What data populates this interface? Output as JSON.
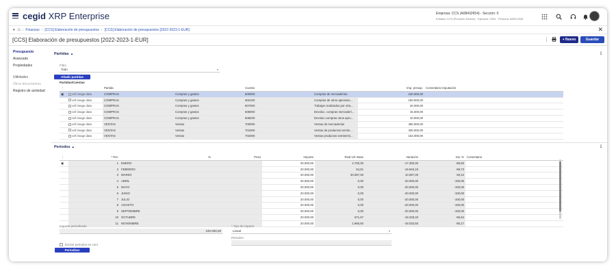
{
  "brand": {
    "bold": "cegid",
    "rest": " XRP Enterprise"
  },
  "empresa": {
    "line1": "Empresa: CCS (A08432654) - Sección: 0",
    "line2": "Entidad: CCS (Provecto Demos) · Ejercicio: 2024 · Persona: ADR12345"
  },
  "breadcrumb": [
    "Finanzas",
    "[CCS] Elaboración de presupuestos",
    "[CCS] Elaboración de presupuestos [2022-2023-1-EUR]"
  ],
  "page_title": "[CCS] Elaboración de presupuestos [2022-2023-1-EUR]",
  "buttons": {
    "nuevo": "+ Nuevo",
    "guardar": "Guardar"
  },
  "sidebar": {
    "items": [
      "Presupuesto",
      "Avanzado",
      "Propiedades"
    ],
    "group": "Utilidades",
    "util_items": [
      "Otros documentos",
      "Registro de actividad"
    ]
  },
  "partidas": {
    "title": "Partidas",
    "filter_label": "Filtro",
    "filter_value": "Todo",
    "add_button": "Añadir partidas",
    "grid_title": "Partidas/Cuentas",
    "columns": [
      "",
      "",
      "Partida",
      "",
      "Cuenta",
      "",
      "Imp. presup.",
      "Comentario imputación"
    ],
    "rows": [
      {
        "img": "cell image data",
        "partida": "COMPRAS",
        "tipo": "Compras y gastos",
        "cuenta": "600000",
        "desc": "Compras de mercaderías",
        "imp": "240.000,00"
      },
      {
        "img": "cell image data",
        "partida": "COMPRAS",
        "tipo": "Compras y gastos",
        "cuenta": "602100",
        "desc": "Compras de otros aprovisio...",
        "imp": "160.000,00"
      },
      {
        "img": "cell image data",
        "partida": "COMPRAS",
        "tipo": "Compras y gastos",
        "cuenta": "607000",
        "desc": "Trabajos realizados por otra...",
        "imp": "20.000,00"
      },
      {
        "img": "cell image data",
        "partida": "COMPRAS",
        "tipo": "Compras y gastos",
        "cuenta": "608000",
        "desc": "Devoluc. compras mercaderí...",
        "imp": "15.000,00"
      },
      {
        "img": "cell image data",
        "partida": "COMPRAS",
        "tipo": "Compras y gastos",
        "cuenta": "608200",
        "desc": "Devoluc.compras otros apro...",
        "imp": "10.000,00"
      },
      {
        "img": "cell image data",
        "partida": "VENTAS",
        "tipo": "Ventas",
        "cuenta": "700000",
        "desc": "Ventas de mercaderías",
        "imp": "480.000,00"
      },
      {
        "img": "cell image data",
        "partida": "VENTAS",
        "tipo": "Ventas",
        "cuenta": "701000",
        "desc": "Ventas de productos termin...",
        "imp": "330.000,00"
      },
      {
        "img": "cell image data",
        "partida": "VENTAS",
        "tipo": "Ventas",
        "cuenta": "702000",
        "desc": "Ventas productos semitermi...",
        "imp": "152.000,00"
      }
    ]
  },
  "periodos": {
    "title": "Periodos",
    "columns": [
      "* Per.",
      "",
      "%",
      "Peso",
      "Importe",
      "Real Ult. Base",
      "Variación",
      "Var. %",
      "Comentario"
    ],
    "rows": [
      {
        "n": "1",
        "mes": "ENERO",
        "imp": "20.000,00",
        "real": "2.700,00",
        "var": "-17.300,00",
        "varp": "-86,50"
      },
      {
        "n": "2",
        "mes": "FEBRERO",
        "imp": "20.000,00",
        "real": "54,81",
        "var": "-19.945,19",
        "varp": "-99,73"
      },
      {
        "n": "3",
        "mes": "MARZO",
        "imp": "20.000,00",
        "real": "30.087,00",
        "var": "10.087,00",
        "varp": "50,44"
      },
      {
        "n": "4",
        "mes": "ABRIL",
        "imp": "20.000,00",
        "real": "0,00",
        "var": "-20.000,00",
        "varp": "-100,00"
      },
      {
        "n": "5",
        "mes": "MAYO",
        "imp": "20.000,00",
        "real": "0,00",
        "var": "-20.000,00",
        "varp": "-100,00"
      },
      {
        "n": "6",
        "mes": "JUNIO",
        "imp": "20.000,00",
        "real": "0,00",
        "var": "-20.000,00",
        "varp": "-100,00"
      },
      {
        "n": "7",
        "mes": "JULIO",
        "imp": "20.000,00",
        "real": "0,00",
        "var": "-20.000,00",
        "varp": "-100,00"
      },
      {
        "n": "8",
        "mes": "AGOSTO",
        "imp": "20.000,00",
        "real": "0,00",
        "var": "-20.000,00",
        "varp": "-100,00"
      },
      {
        "n": "9",
        "mes": "SEPTIEMBRE",
        "imp": "20.000,00",
        "real": "0,00",
        "var": "-20.000,00",
        "varp": "-100,00"
      },
      {
        "n": "10",
        "mes": "OCTUBRE",
        "imp": "20.000,00",
        "real": "671,67",
        "var": "-19.328,33",
        "varp": "-96,64"
      },
      {
        "n": "11",
        "mes": "NOVIEMBRE",
        "imp": "20.000,00",
        "real": "1.966,50",
        "var": "-18.033,50",
        "varp": "-90,17"
      }
    ],
    "importe_label": "Importe periodizado",
    "importe_value": "240.000,00",
    "reparto_label": "* Tipo de reparto",
    "reparto_value": "Lineal",
    "periodos_label": "Periodos",
    "excluir_label": "Excluir periodos en cero",
    "periodizar_button": "Periodizar"
  },
  "colors": {
    "brand": "#1f2a5a",
    "primary": "#1f2a8a",
    "selection": "#c7d4ef"
  }
}
